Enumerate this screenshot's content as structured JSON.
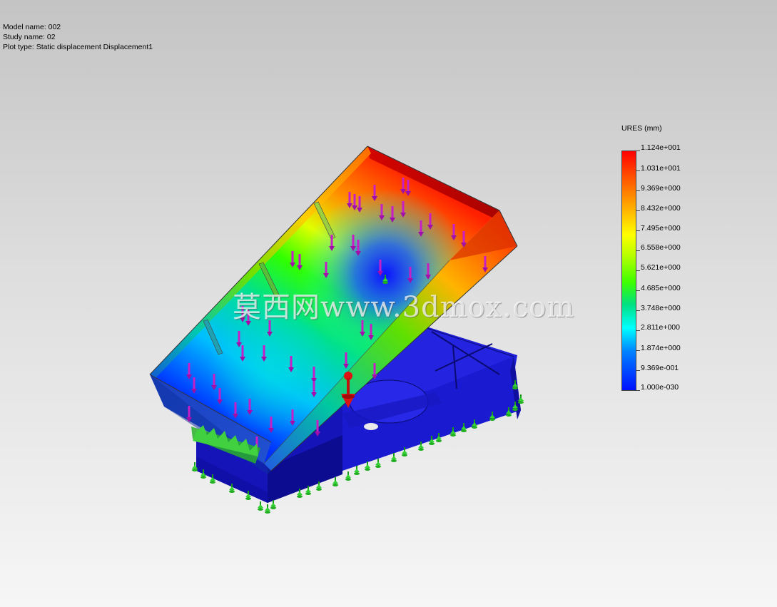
{
  "info": {
    "model_name": "Model name: 002",
    "study_name": "Study name: 02",
    "plot_type": "Plot type: Static displacement Displacement1"
  },
  "legend": {
    "title": "URES (mm)",
    "labels": [
      "1.124e+001",
      "1.031e+001",
      "9.369e+000",
      "8.432e+000",
      "7.495e+000",
      "6.558e+000",
      "5.621e+000",
      "4.685e+000",
      "3.748e+000",
      "2.811e+000",
      "1.874e+000",
      "9.369e-001",
      "1.000e-030"
    ]
  },
  "watermark": "莫西网www.3dmox.com",
  "colors": {
    "base_blue": "#1414c8",
    "load_arrow": "#c81ec8",
    "fixture_green": "#28c828",
    "remote_load": "#dc1414"
  }
}
